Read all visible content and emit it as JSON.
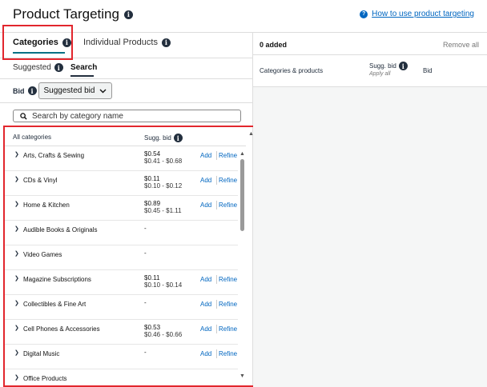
{
  "header": {
    "title": "Product Targeting",
    "help_link": "How to use product targeting"
  },
  "tabs": {
    "categories": "Categories",
    "individual": "Individual Products"
  },
  "subtabs": {
    "suggested": "Suggested",
    "search": "Search"
  },
  "bid": {
    "label": "Bid",
    "select_value": "Suggested bid"
  },
  "search": {
    "placeholder": "Search by category name"
  },
  "table": {
    "col_category": "All categories",
    "col_bid": "Sugg. bid",
    "rows": [
      {
        "name": "Arts, Crafts & Sewing",
        "bid": "$0.54",
        "range": "$0.41 - $0.68",
        "add": "Add",
        "refine": "Refine"
      },
      {
        "name": "CDs & Vinyl",
        "bid": "$0.11",
        "range": "$0.10 - $0.12",
        "add": "Add",
        "refine": "Refine"
      },
      {
        "name": "Home & Kitchen",
        "bid": "$0.89",
        "range": "$0.45 - $1.11",
        "add": "Add",
        "refine": "Refine"
      },
      {
        "name": "Audible Books & Originals",
        "bid": "-",
        "range": "",
        "add": "",
        "refine": ""
      },
      {
        "name": "Video Games",
        "bid": "-",
        "range": "",
        "add": "",
        "refine": ""
      },
      {
        "name": "Magazine Subscriptions",
        "bid": "$0.11",
        "range": "$0.10 - $0.14",
        "add": "Add",
        "refine": "Refine"
      },
      {
        "name": "Collectibles & Fine Art",
        "bid": "-",
        "range": "",
        "add": "Add",
        "refine": "Refine"
      },
      {
        "name": "Cell Phones & Accessories",
        "bid": "$0.53",
        "range": "$0.46 - $0.66",
        "add": "Add",
        "refine": "Refine"
      },
      {
        "name": "Digital Music",
        "bid": "-",
        "range": "",
        "add": "Add",
        "refine": "Refine"
      },
      {
        "name": "Office Products",
        "bid": "",
        "range": "",
        "add": "",
        "refine": ""
      }
    ]
  },
  "right": {
    "added": "0 added",
    "remove_all": "Remove all",
    "col_categories": "Categories & products",
    "col_sugg_bid": "Sugg. bid",
    "apply_all": "Apply all",
    "col_bid": "Bid"
  },
  "colors": {
    "highlight": "#e2262d",
    "link": "#0066c0",
    "tab_underline": "#007185"
  }
}
